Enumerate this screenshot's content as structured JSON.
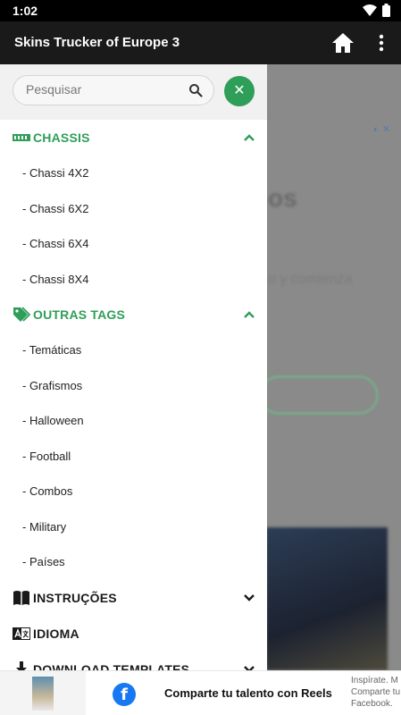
{
  "status_bar": {
    "time": "1:02"
  },
  "app_bar": {
    "title": "Skins Trucker of Europe 3"
  },
  "search": {
    "placeholder": "Pesquisar"
  },
  "close_button": {
    "glyph": "✕"
  },
  "sections": {
    "chassis": {
      "label": "CHASSIS",
      "items": [
        "- Chassi 4X2",
        "- Chassi 6X2",
        "- Chassi 6X4",
        "- Chassi 8X4"
      ]
    },
    "outras_tags": {
      "label": "OUTRAS TAGS",
      "items": [
        "- Temáticas",
        "- Grafismos",
        "- Halloween",
        "- Football",
        "- Combos",
        "- Military",
        "- Países"
      ]
    },
    "instrucoes": {
      "label": "INSTRUÇÕES"
    },
    "idioma": {
      "label": "IDIOMA"
    },
    "download": {
      "label": "DOWNLOAD TEMPLATES"
    }
  },
  "ad": {
    "headline": "Comparte tu talento con Reels",
    "side_text_1": "Inspírate. M",
    "side_text_2": "Comparte tu",
    "side_text_3": "Facebook."
  },
  "background": {
    "heading_fragment": "os",
    "text_fragment": "o y comienza"
  },
  "colors": {
    "accent": "#2e9e58",
    "appbar": "#1a1a1a",
    "status_bar": "#000000",
    "facebook": "#1877f2"
  }
}
